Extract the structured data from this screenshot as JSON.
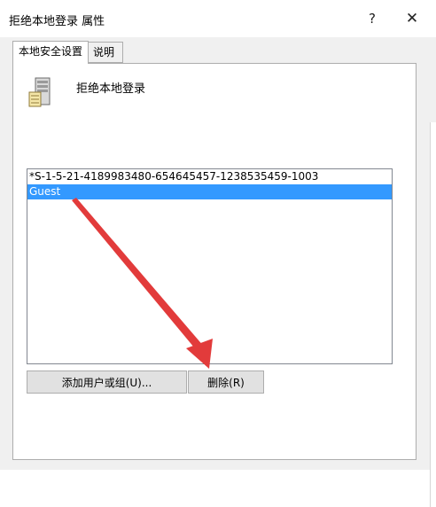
{
  "window": {
    "title": "拒绝本地登录 属性",
    "help_glyph": "?",
    "close_glyph": "✕"
  },
  "tabs": [
    {
      "label": "本地安全设置",
      "active": true
    },
    {
      "label": "说明",
      "active": false
    }
  ],
  "policy": {
    "icon": "server-icon",
    "name": "拒绝本地登录"
  },
  "accounts": [
    {
      "name": "*S-1-5-21-4189983480-654645457-1238535459-1003",
      "selected": false
    },
    {
      "name": "Guest",
      "selected": true
    }
  ],
  "buttons": {
    "add": "添加用户或组(U)...",
    "remove": "删除(R)"
  },
  "annotation": {
    "type": "red-arrow",
    "color": "#e23b3b"
  },
  "colors": {
    "selection": "#3399ff",
    "dialog_bg": "#f0f0f0"
  }
}
